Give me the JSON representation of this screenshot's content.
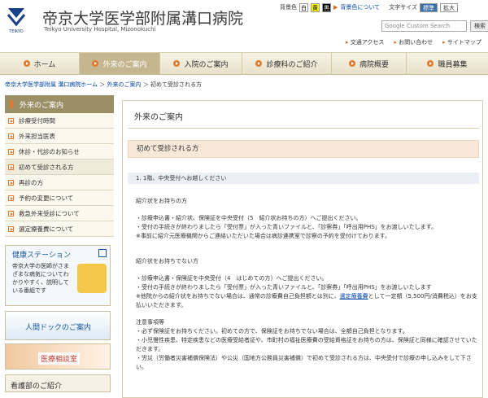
{
  "header": {
    "title": "帝京大学医学部附属溝口病院",
    "subtitle": "Teikyo University Hospital, Mizonokuchi",
    "logo_text": "TEIKYO",
    "bg_label": "背景色",
    "bg_options": [
      "白",
      "黄",
      "黒"
    ],
    "bg_about": "背景色について",
    "font_size_label": "文字サイズ",
    "font_sizes": [
      "標準",
      "拡大"
    ],
    "search_placeholder": "Google Custom Search",
    "search_button": "検索",
    "sub_links": [
      "交通アクセス",
      "お問い合わせ",
      "サイトマップ"
    ]
  },
  "nav": {
    "items": [
      "ホーム",
      "外来のご案内",
      "入院のご案内",
      "診療科のご紹介",
      "病院概要",
      "職員募集"
    ],
    "active_index": 1
  },
  "breadcrumb": {
    "home": "帝京大学医学部附属 溝口病院ホーム",
    "parent": "外来のご案内",
    "current": "初めて受診される方"
  },
  "sidebar": {
    "title": "外来のご案内",
    "items": [
      "診療受付時間",
      "外来担当医表",
      "休診・代診のお知らせ",
      "初めて受診される方",
      "再診の方",
      "予約の変更について",
      "救急外来受診について",
      "選定療養費について"
    ],
    "current_index": 3,
    "banners": {
      "health_station_title": "健康ステーション",
      "health_station_text": "帝京大学の医師がさまざまな病気についてわかりやすく、説明している番組です",
      "dock": "人間ドックのご案内",
      "consult": "医療相談室",
      "nursing": "看護部のご紹介"
    }
  },
  "main": {
    "page_title": "外来のご案内",
    "section_title": "初めて受診される方",
    "sub_title": "1. 1階、中央受付へお越しください",
    "with_referral_heading": "紹介状をお持ちの方",
    "with_referral_lines": [
      "・診療申込書・紹介状、保険証を中央受付（5　紹介状お持ちの方）へご提出ください。",
      "・受付の手続きが終わりましたら「受付票」が入った青いファイルと、「診察券」「呼出用PHS」をお渡しいたします。",
      "※事前に紹介元医療機関からご連絡いただいた場合は病診連携室で診察の予約を受付けております。"
    ],
    "without_referral_heading": "紹介状をお持ちでない方",
    "without_referral_lines": [
      "・診療申込書・保険証を中央受付（4　はじめての方）へご提出ください。",
      "・受付の手続きが終わりましたら「受付票」が入った青いファイルと、「診察券」「呼出用PHS」をお渡しいたします"
    ],
    "without_referral_note_a": "※他院からの紹介状をお持ちでない場合は、通常の診療費自己負担額とは別に、",
    "without_referral_note_link": "選定療養費",
    "without_referral_note_b": "として一定額（5,500円/消費税込）をお支払いいただきます。",
    "notes_heading": "注意事項等",
    "notes_lines": [
      "・必ず保険証をお持ちください。初めての方で、保険証をお持ちでない場合は、全額自己負担となります。",
      "・小児慢性疾患、特定疾患などの医療受給者証や、市町村の福祉医療費の受給資格証をお持ちの方は、保険証と同様に確認させていただきます。",
      "・労災（労働者災害補償保険法）や公災（国地方公務員災害補償）で初めて受診される方は、中央受付で診療の申し込みをして下さい。"
    ]
  },
  "colors": {
    "accent_orange": "#e07a2e",
    "nav_active": "#c4b78f",
    "sidebar_head": "#9b8f66",
    "link_blue": "#0044aa"
  }
}
